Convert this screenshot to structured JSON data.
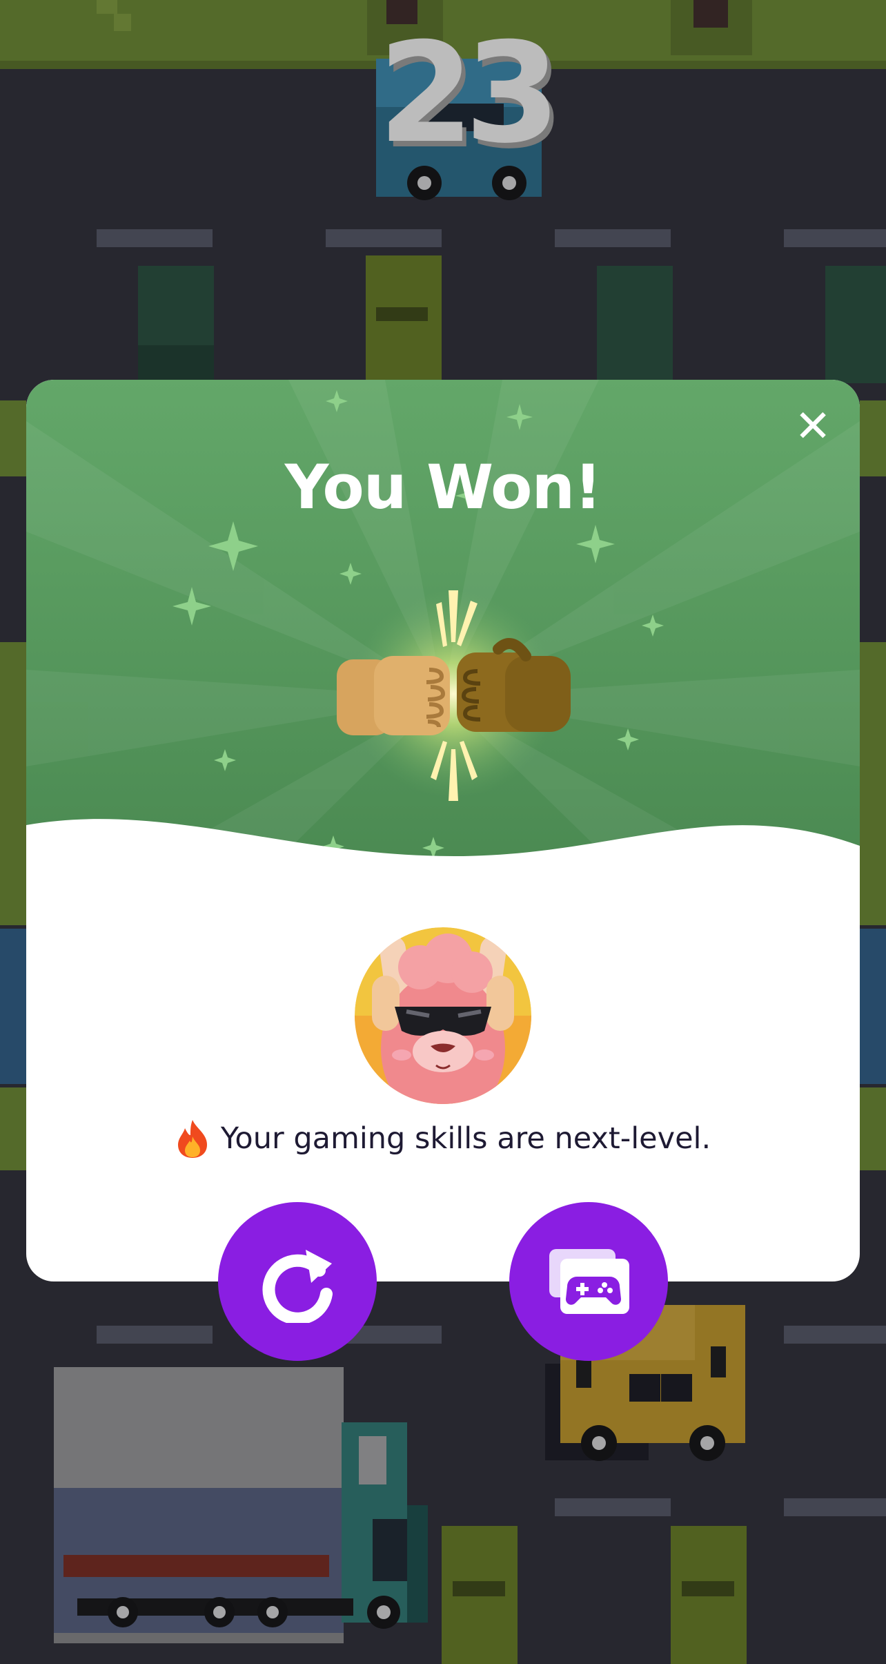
{
  "game": {
    "score": "23"
  },
  "modal": {
    "title": "You Won!",
    "close_icon": "close-icon",
    "hero_icon": "fist-bump-icon",
    "avatar_icon": "llama-sunglasses-avatar",
    "message_icon": "fire-emoji",
    "message": "Your gaming skills are next-level."
  },
  "actions": [
    {
      "name": "replay-button",
      "icon": "replay-icon"
    },
    {
      "name": "more-games-button",
      "icon": "game-library-icon"
    }
  ],
  "colors": {
    "accent": "#8a1ee2",
    "modal_header": "#5fa05f",
    "road": "#2c2d36",
    "grass": "#6a8a2e"
  }
}
